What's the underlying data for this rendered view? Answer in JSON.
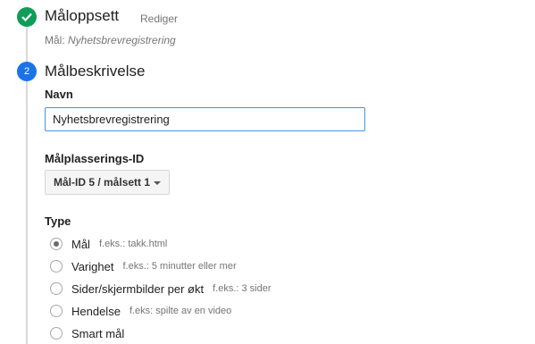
{
  "steps": {
    "step1": {
      "title": "Måloppsett",
      "edit_label": "Rediger",
      "summary_prefix": "Mål:",
      "summary_value": "Nyhetsbrevregistrering"
    },
    "step2": {
      "number": "2",
      "title": "Målbeskrivelse"
    }
  },
  "form": {
    "name_label": "Navn",
    "name_value": "Nyhetsbrevregistrering",
    "slot_label": "Målplasserings-ID",
    "slot_value": "Mål-ID 5 / målsett 1",
    "type_label": "Type",
    "types": [
      {
        "label": "Mål",
        "hint": "f.eks.: takk.html",
        "checked": true
      },
      {
        "label": "Varighet",
        "hint": "f.eks.: 5 minutter eller mer",
        "checked": false
      },
      {
        "label": "Sider/skjermbilder per økt",
        "hint": "f.eks.: 3 sider",
        "checked": false
      },
      {
        "label": "Hendelse",
        "hint": "f.eks: spilte av en video",
        "checked": false
      },
      {
        "label": "Smart mål",
        "hint": "",
        "checked": false
      }
    ]
  },
  "colors": {
    "done": "#0f9d58",
    "active": "#1a73e8",
    "input_border": "#4a90e2"
  }
}
